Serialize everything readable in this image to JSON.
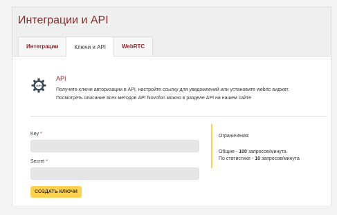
{
  "page": {
    "title": "Интеграции и API"
  },
  "tabs": [
    {
      "label": "Интеграции",
      "active": false
    },
    {
      "label": "Ключи и API",
      "active": true
    },
    {
      "label": "WebRTC",
      "active": false
    }
  ],
  "api_section": {
    "icon": "gear-api-icon",
    "title": "API",
    "description_line1": "Получите ключи авторизации в API, настройте ссылку для уведомлений или установите webrtc виджет.",
    "description_line2": "Посмотреть описание всех методов API Novofon можно в разделе API на нашем сайте"
  },
  "form": {
    "key_label": "Key",
    "key_value": "",
    "secret_label": "Secret",
    "secret_value": "",
    "required_mark": "*",
    "create_button": "СОЗДАТЬ КЛЮЧИ"
  },
  "limits": {
    "title": "Ограничения:",
    "total_prefix": "Общие - ",
    "total_value": "100",
    "total_suffix": " запросов/минута",
    "stats_prefix": "По статистике - ",
    "stats_value": "10",
    "stats_suffix": " запросов/минута"
  },
  "colors": {
    "accent_text": "#8a2a2a",
    "button_yellow": "#ffd350",
    "required_red": "#d33333"
  }
}
